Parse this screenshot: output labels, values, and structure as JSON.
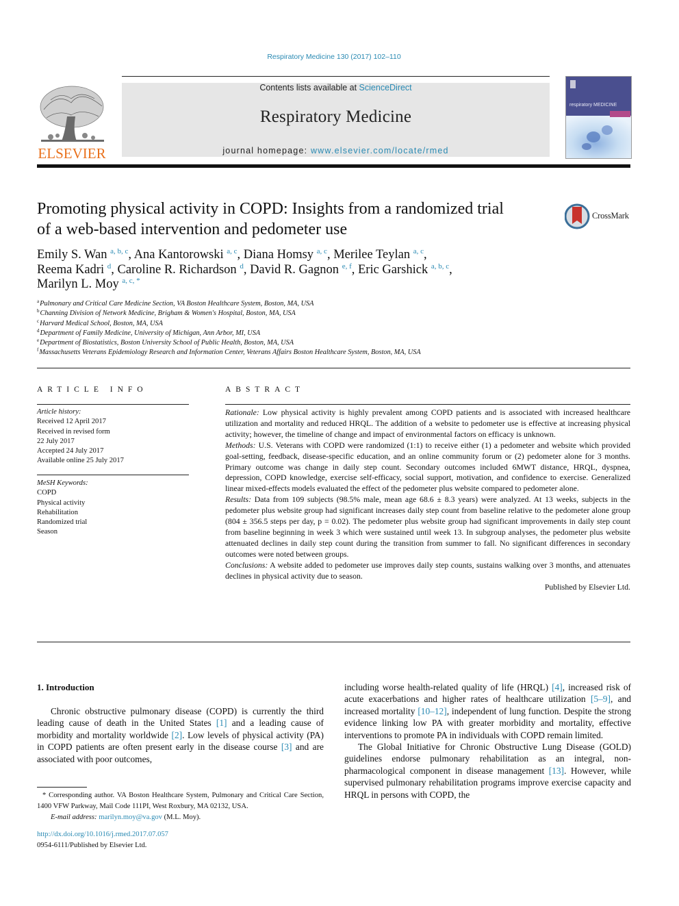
{
  "header": {
    "journal_reference": "Respiratory Medicine 130 (2017) 102–110",
    "contents_prefix": "Contents lists available at ",
    "contents_link": "ScienceDirect",
    "journal_title": "Respiratory Medicine",
    "homepage_prefix": "journal homepage: ",
    "homepage_link": "www.elsevier.com/locate/rmed",
    "publisher_logo_text": "ELSEVIER",
    "cover_title": "respiratory MEDICINE",
    "crossmark_label": "CrossMark",
    "colors": {
      "link": "#2a8ab3",
      "elsevier_orange": "#e9711c",
      "masthead_bg": "#e6e6e6",
      "cover_blue": "#4a4f8f"
    }
  },
  "article": {
    "title_line1": "Promoting physical activity in COPD: Insights from a randomized trial",
    "title_line2": "of a web-based intervention and pedometer use",
    "authors": [
      {
        "name": "Emily S. Wan",
        "affil": "a, b, c",
        "sep": ", "
      },
      {
        "name": "Ana Kantorowski",
        "affil": "a, c",
        "sep": ", "
      },
      {
        "name": "Diana Homsy",
        "affil": "a, c",
        "sep": ", "
      },
      {
        "name": "Merilee Teylan",
        "affil": "a, c",
        "sep": ","
      },
      {
        "name": "Reema Kadri",
        "affil": "d",
        "sep": ", "
      },
      {
        "name": "Caroline R. Richardson",
        "affil": "d",
        "sep": ", "
      },
      {
        "name": "David R. Gagnon",
        "affil": "e, f",
        "sep": ", "
      },
      {
        "name": "Eric Garshick",
        "affil": "a, b, c",
        "sep": ","
      },
      {
        "name": "Marilyn L. Moy",
        "affil": "a, c, *",
        "sep": ""
      }
    ],
    "affiliations": [
      {
        "key": "a",
        "text": "Pulmonary and Critical Care Medicine Section, VA Boston Healthcare System, Boston, MA, USA"
      },
      {
        "key": "b",
        "text": "Channing Division of Network Medicine, Brigham & Women's Hospital, Boston, MA, USA"
      },
      {
        "key": "c",
        "text": "Harvard Medical School, Boston, MA, USA"
      },
      {
        "key": "d",
        "text": "Department of Family Medicine, University of Michigan, Ann Arbor, MI, USA"
      },
      {
        "key": "e",
        "text": "Department of Biostatistics, Boston University School of Public Health, Boston, MA, USA"
      },
      {
        "key": "f",
        "text": "Massachusetts Veterans Epidemiology Research and Information Center, Veterans Affairs Boston Healthcare System, Boston, MA, USA"
      }
    ]
  },
  "article_info": {
    "heading": "ARTICLE INFO",
    "history_label": "Article history:",
    "history": [
      "Received 12 April 2017",
      "Received in revised form",
      "22 July 2017",
      "Accepted 24 July 2017",
      "Available online 25 July 2017"
    ],
    "keywords_label": "MeSH Keywords:",
    "keywords": [
      "COPD",
      "Physical activity",
      "Rehabilitation",
      "Randomized trial",
      "Season"
    ]
  },
  "abstract": {
    "heading": "ABSTRACT",
    "sections": [
      {
        "label": "Rationale:",
        "text": " Low physical activity is highly prevalent among COPD patients and is associated with increased healthcare utilization and mortality and reduced HRQL. The addition of a website to pedometer use is effective at increasing physical activity; however, the timeline of change and impact of environmental factors on efficacy is unknown."
      },
      {
        "label": "Methods:",
        "text": " U.S. Veterans with COPD were randomized (1:1) to receive either (1) a pedometer and website which provided goal-setting, feedback, disease-specific education, and an online community forum or (2) pedometer alone for 3 months. Primary outcome was change in daily step count. Secondary outcomes included 6MWT distance, HRQL, dyspnea, depression, COPD knowledge, exercise self-efficacy, social support, motivation, and confidence to exercise. Generalized linear mixed-effects models evaluated the effect of the pedometer plus website compared to pedometer alone."
      },
      {
        "label": "Results:",
        "text": " Data from 109 subjects (98.5% male, mean age 68.6 ± 8.3 years) were analyzed. At 13 weeks, subjects in the pedometer plus website group had significant increases daily step count from baseline relative to the pedometer alone group (804 ± 356.5 steps per day, p = 0.02). The pedometer plus website group had significant improvements in daily step count from baseline beginning in week 3 which were sustained until week 13. In subgroup analyses, the pedometer plus website attenuated declines in daily step count during the transition from summer to fall. No significant differences in secondary outcomes were noted between groups."
      },
      {
        "label": "Conclusions:",
        "text": " A website added to pedometer use improves daily step counts, sustains walking over 3 months, and attenuates declines in physical activity due to season."
      }
    ],
    "published_by": "Published by Elsevier Ltd."
  },
  "body": {
    "section_heading": "1.  Introduction",
    "left_para": [
      {
        "t": "Chronic obstructive pulmonary disease (COPD) is currently the third leading cause of death in the United States "
      },
      {
        "ref": "[1]"
      },
      {
        "t": " and a leading cause of morbidity and mortality worldwide "
      },
      {
        "ref": "[2]"
      },
      {
        "t": ". Low levels of physical activity (PA) in COPD patients are often present early in the disease course "
      },
      {
        "ref": "[3]"
      },
      {
        "t": " and are associated with poor outcomes,"
      }
    ],
    "right_para1": [
      {
        "t": "including worse health-related quality of life (HRQL) "
      },
      {
        "ref": "[4]"
      },
      {
        "t": ", increased risk of acute exacerbations and higher rates of healthcare utilization "
      },
      {
        "ref": "[5–9]"
      },
      {
        "t": ", and increased mortality "
      },
      {
        "ref": "[10–12]"
      },
      {
        "t": ", independent of lung function. Despite the strong evidence linking low PA with greater morbidity and mortality, effective interventions to promote PA in individuals with COPD remain limited."
      }
    ],
    "right_para2": [
      {
        "t": "The Global Initiative for Chronic Obstructive Lung Disease (GOLD) guidelines endorse pulmonary rehabilitation as an integral, non-pharmacological component in disease management "
      },
      {
        "ref": "[13]"
      },
      {
        "t": ". However, while supervised pulmonary rehabilitation programs improve exercise capacity and HRQL in persons with COPD, the"
      }
    ]
  },
  "footnote": {
    "corresponding": "* Corresponding author. VA Boston Healthcare System, Pulmonary and Critical Care Section, 1400 VFW Parkway, Mail Code 111PI, West Roxbury, MA 02132, USA.",
    "email_label": "E-mail address:",
    "email": "marilyn.moy@va.gov",
    "email_suffix": " (M.L. Moy).",
    "doi": "http://dx.doi.org/10.1016/j.rmed.2017.07.057",
    "issn_line": "0954-6111/Published by Elsevier Ltd."
  }
}
